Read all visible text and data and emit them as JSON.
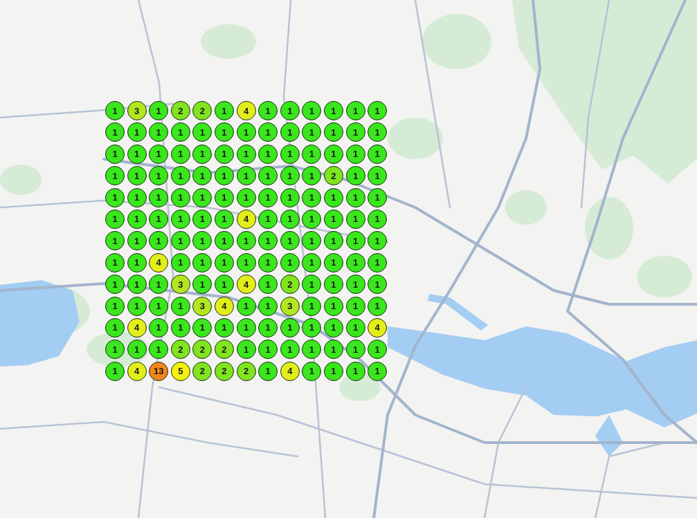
{
  "map": {
    "grid": [
      [
        {
          "rank": "1",
          "color": "#3ae61c"
        },
        {
          "rank": "3",
          "color": "#b2e620"
        },
        {
          "rank": "1",
          "color": "#3ae61c"
        },
        {
          "rank": "2",
          "color": "#80e41e"
        },
        {
          "rank": "2",
          "color": "#80e41e"
        },
        {
          "rank": "1",
          "color": "#3ae61c"
        },
        {
          "rank": "4",
          "color": "#e2ee1a"
        },
        {
          "rank": "1",
          "color": "#3ae61c"
        },
        {
          "rank": "1",
          "color": "#3ae61c"
        },
        {
          "rank": "1",
          "color": "#3ae61c"
        },
        {
          "rank": "1",
          "color": "#3ae61c"
        },
        {
          "rank": "1",
          "color": "#3ae61c"
        },
        {
          "rank": "1",
          "color": "#3ae61c"
        }
      ],
      [
        {
          "rank": "1",
          "color": "#3ae61c"
        },
        {
          "rank": "1",
          "color": "#3ae61c"
        },
        {
          "rank": "1",
          "color": "#3ae61c"
        },
        {
          "rank": "1",
          "color": "#3ae61c"
        },
        {
          "rank": "1",
          "color": "#3ae61c"
        },
        {
          "rank": "1",
          "color": "#3ae61c"
        },
        {
          "rank": "1",
          "color": "#3ae61c"
        },
        {
          "rank": "1",
          "color": "#3ae61c"
        },
        {
          "rank": "1",
          "color": "#3ae61c"
        },
        {
          "rank": "1",
          "color": "#3ae61c"
        },
        {
          "rank": "1",
          "color": "#3ae61c"
        },
        {
          "rank": "1",
          "color": "#3ae61c"
        },
        {
          "rank": "1",
          "color": "#3ae61c"
        }
      ],
      [
        {
          "rank": "1",
          "color": "#3ae61c"
        },
        {
          "rank": "1",
          "color": "#3ae61c"
        },
        {
          "rank": "1",
          "color": "#3ae61c"
        },
        {
          "rank": "1",
          "color": "#3ae61c"
        },
        {
          "rank": "1",
          "color": "#3ae61c"
        },
        {
          "rank": "1",
          "color": "#3ae61c"
        },
        {
          "rank": "1",
          "color": "#3ae61c"
        },
        {
          "rank": "1",
          "color": "#3ae61c"
        },
        {
          "rank": "1",
          "color": "#3ae61c"
        },
        {
          "rank": "1",
          "color": "#3ae61c"
        },
        {
          "rank": "1",
          "color": "#3ae61c"
        },
        {
          "rank": "1",
          "color": "#3ae61c"
        },
        {
          "rank": "1",
          "color": "#3ae61c"
        }
      ],
      [
        {
          "rank": "1",
          "color": "#3ae61c"
        },
        {
          "rank": "1",
          "color": "#3ae61c"
        },
        {
          "rank": "1",
          "color": "#3ae61c"
        },
        {
          "rank": "1",
          "color": "#3ae61c"
        },
        {
          "rank": "1",
          "color": "#3ae61c"
        },
        {
          "rank": "1",
          "color": "#3ae61c"
        },
        {
          "rank": "1",
          "color": "#3ae61c"
        },
        {
          "rank": "1",
          "color": "#3ae61c"
        },
        {
          "rank": "1",
          "color": "#3ae61c"
        },
        {
          "rank": "1",
          "color": "#3ae61c"
        },
        {
          "rank": "2",
          "color": "#80e41e"
        },
        {
          "rank": "1",
          "color": "#3ae61c"
        },
        {
          "rank": "1",
          "color": "#3ae61c"
        }
      ],
      [
        {
          "rank": "1",
          "color": "#3ae61c"
        },
        {
          "rank": "1",
          "color": "#3ae61c"
        },
        {
          "rank": "1",
          "color": "#3ae61c"
        },
        {
          "rank": "1",
          "color": "#3ae61c"
        },
        {
          "rank": "1",
          "color": "#3ae61c"
        },
        {
          "rank": "1",
          "color": "#3ae61c"
        },
        {
          "rank": "1",
          "color": "#3ae61c"
        },
        {
          "rank": "1",
          "color": "#3ae61c"
        },
        {
          "rank": "1",
          "color": "#3ae61c"
        },
        {
          "rank": "1",
          "color": "#3ae61c"
        },
        {
          "rank": "1",
          "color": "#3ae61c"
        },
        {
          "rank": "1",
          "color": "#3ae61c"
        },
        {
          "rank": "1",
          "color": "#3ae61c"
        }
      ],
      [
        {
          "rank": "1",
          "color": "#3ae61c"
        },
        {
          "rank": "1",
          "color": "#3ae61c"
        },
        {
          "rank": "1",
          "color": "#3ae61c"
        },
        {
          "rank": "1",
          "color": "#3ae61c"
        },
        {
          "rank": "1",
          "color": "#3ae61c"
        },
        {
          "rank": "1",
          "color": "#3ae61c"
        },
        {
          "rank": "4",
          "color": "#e2ee1a"
        },
        {
          "rank": "1",
          "color": "#3ae61c"
        },
        {
          "rank": "1",
          "color": "#3ae61c"
        },
        {
          "rank": "1",
          "color": "#3ae61c"
        },
        {
          "rank": "1",
          "color": "#3ae61c"
        },
        {
          "rank": "1",
          "color": "#3ae61c"
        },
        {
          "rank": "1",
          "color": "#3ae61c"
        }
      ],
      [
        {
          "rank": "1",
          "color": "#3ae61c"
        },
        {
          "rank": "1",
          "color": "#3ae61c"
        },
        {
          "rank": "1",
          "color": "#3ae61c"
        },
        {
          "rank": "1",
          "color": "#3ae61c"
        },
        {
          "rank": "1",
          "color": "#3ae61c"
        },
        {
          "rank": "1",
          "color": "#3ae61c"
        },
        {
          "rank": "1",
          "color": "#3ae61c"
        },
        {
          "rank": "1",
          "color": "#3ae61c"
        },
        {
          "rank": "1",
          "color": "#3ae61c"
        },
        {
          "rank": "1",
          "color": "#3ae61c"
        },
        {
          "rank": "1",
          "color": "#3ae61c"
        },
        {
          "rank": "1",
          "color": "#3ae61c"
        },
        {
          "rank": "1",
          "color": "#3ae61c"
        }
      ],
      [
        {
          "rank": "1",
          "color": "#3ae61c"
        },
        {
          "rank": "1",
          "color": "#3ae61c"
        },
        {
          "rank": "4",
          "color": "#e2ee1a"
        },
        {
          "rank": "1",
          "color": "#3ae61c"
        },
        {
          "rank": "1",
          "color": "#3ae61c"
        },
        {
          "rank": "1",
          "color": "#3ae61c"
        },
        {
          "rank": "1",
          "color": "#3ae61c"
        },
        {
          "rank": "1",
          "color": "#3ae61c"
        },
        {
          "rank": "1",
          "color": "#3ae61c"
        },
        {
          "rank": "1",
          "color": "#3ae61c"
        },
        {
          "rank": "1",
          "color": "#3ae61c"
        },
        {
          "rank": "1",
          "color": "#3ae61c"
        },
        {
          "rank": "1",
          "color": "#3ae61c"
        }
      ],
      [
        {
          "rank": "1",
          "color": "#3ae61c"
        },
        {
          "rank": "1",
          "color": "#3ae61c"
        },
        {
          "rank": "1",
          "color": "#3ae61c"
        },
        {
          "rank": "3",
          "color": "#b2e620"
        },
        {
          "rank": "1",
          "color": "#3ae61c"
        },
        {
          "rank": "1",
          "color": "#3ae61c"
        },
        {
          "rank": "4",
          "color": "#e2ee1a"
        },
        {
          "rank": "1",
          "color": "#3ae61c"
        },
        {
          "rank": "2",
          "color": "#80e41e"
        },
        {
          "rank": "1",
          "color": "#3ae61c"
        },
        {
          "rank": "1",
          "color": "#3ae61c"
        },
        {
          "rank": "1",
          "color": "#3ae61c"
        },
        {
          "rank": "1",
          "color": "#3ae61c"
        }
      ],
      [
        {
          "rank": "1",
          "color": "#3ae61c"
        },
        {
          "rank": "1",
          "color": "#3ae61c"
        },
        {
          "rank": "1",
          "color": "#3ae61c"
        },
        {
          "rank": "1",
          "color": "#3ae61c"
        },
        {
          "rank": "3",
          "color": "#b2e620"
        },
        {
          "rank": "4",
          "color": "#e2ee1a"
        },
        {
          "rank": "1",
          "color": "#3ae61c"
        },
        {
          "rank": "1",
          "color": "#3ae61c"
        },
        {
          "rank": "3",
          "color": "#b2e620"
        },
        {
          "rank": "1",
          "color": "#3ae61c"
        },
        {
          "rank": "1",
          "color": "#3ae61c"
        },
        {
          "rank": "1",
          "color": "#3ae61c"
        },
        {
          "rank": "1",
          "color": "#3ae61c"
        }
      ],
      [
        {
          "rank": "1",
          "color": "#3ae61c"
        },
        {
          "rank": "4",
          "color": "#e2ee1a"
        },
        {
          "rank": "1",
          "color": "#3ae61c"
        },
        {
          "rank": "1",
          "color": "#3ae61c"
        },
        {
          "rank": "1",
          "color": "#3ae61c"
        },
        {
          "rank": "1",
          "color": "#3ae61c"
        },
        {
          "rank": "1",
          "color": "#3ae61c"
        },
        {
          "rank": "1",
          "color": "#3ae61c"
        },
        {
          "rank": "1",
          "color": "#3ae61c"
        },
        {
          "rank": "1",
          "color": "#3ae61c"
        },
        {
          "rank": "1",
          "color": "#3ae61c"
        },
        {
          "rank": "1",
          "color": "#3ae61c"
        },
        {
          "rank": "4",
          "color": "#e2ee1a"
        }
      ],
      [
        {
          "rank": "1",
          "color": "#3ae61c"
        },
        {
          "rank": "1",
          "color": "#3ae61c"
        },
        {
          "rank": "1",
          "color": "#3ae61c"
        },
        {
          "rank": "2",
          "color": "#80e41e"
        },
        {
          "rank": "2",
          "color": "#80e41e"
        },
        {
          "rank": "2",
          "color": "#80e41e"
        },
        {
          "rank": "1",
          "color": "#3ae61c"
        },
        {
          "rank": "1",
          "color": "#3ae61c"
        },
        {
          "rank": "1",
          "color": "#3ae61c"
        },
        {
          "rank": "1",
          "color": "#3ae61c"
        },
        {
          "rank": "1",
          "color": "#3ae61c"
        },
        {
          "rank": "1",
          "color": "#3ae61c"
        },
        {
          "rank": "1",
          "color": "#3ae61c"
        }
      ],
      [
        {
          "rank": "1",
          "color": "#3ae61c"
        },
        {
          "rank": "4",
          "color": "#e2ee1a"
        },
        {
          "rank": "13",
          "color": "#f0861a"
        },
        {
          "rank": "5",
          "color": "#f4f010"
        },
        {
          "rank": "2",
          "color": "#80e41e"
        },
        {
          "rank": "2",
          "color": "#80e41e"
        },
        {
          "rank": "2",
          "color": "#80e41e"
        },
        {
          "rank": "1",
          "color": "#3ae61c"
        },
        {
          "rank": "4",
          "color": "#e2ee1a"
        },
        {
          "rank": "1",
          "color": "#3ae61c"
        },
        {
          "rank": "1",
          "color": "#3ae61c"
        },
        {
          "rank": "1",
          "color": "#3ae61c"
        },
        {
          "rank": "1",
          "color": "#3ae61c"
        }
      ]
    ]
  }
}
